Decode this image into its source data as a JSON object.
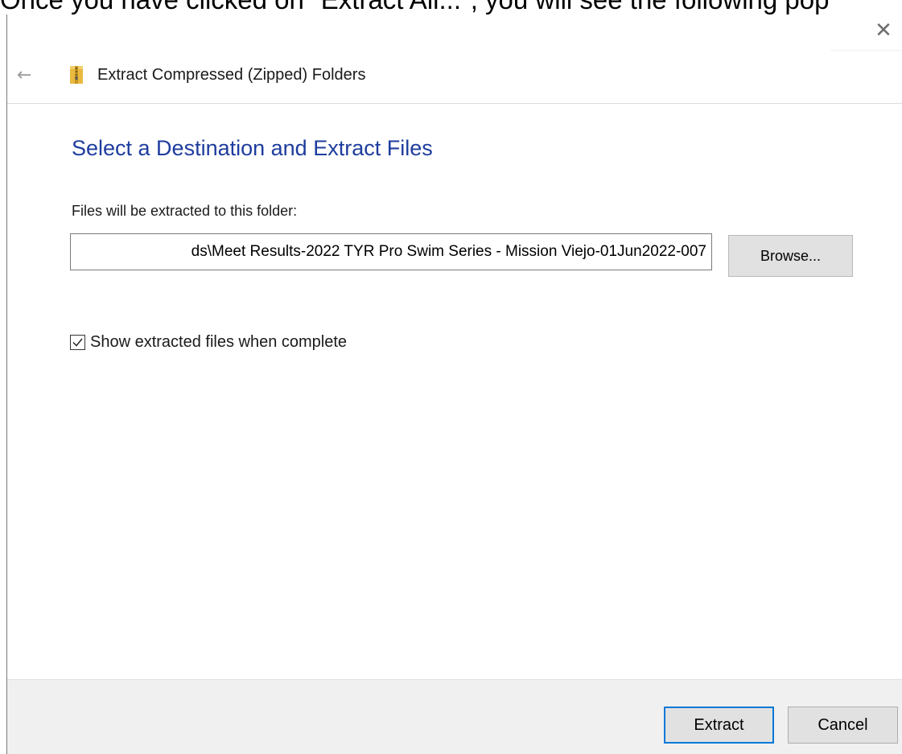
{
  "caption": {
    "text": "Once you have clicked on \"Extract All...\", you will see the following pop"
  },
  "window": {
    "title": "Extract Compressed (Zipped) Folders",
    "close_glyph": "✕",
    "back_glyph": "←",
    "icon": "zip-folder-icon"
  },
  "main": {
    "heading": "Select a Destination and Extract Files",
    "folder_label": "Files will be extracted to this folder:",
    "path_value": "ds\\Meet Results-2022 TYR Pro Swim Series - Mission Viejo-01Jun2022-007",
    "browse_label": "Browse...",
    "show_files_label": "Show extracted files when complete",
    "show_files_checked": true
  },
  "footer": {
    "extract_label": "Extract",
    "cancel_label": "Cancel"
  },
  "colors": {
    "heading": "#1e3c9e",
    "default_button_border": "#0078d7",
    "button_face": "#e1e1e1",
    "footer_bg": "#f0f0f0"
  }
}
